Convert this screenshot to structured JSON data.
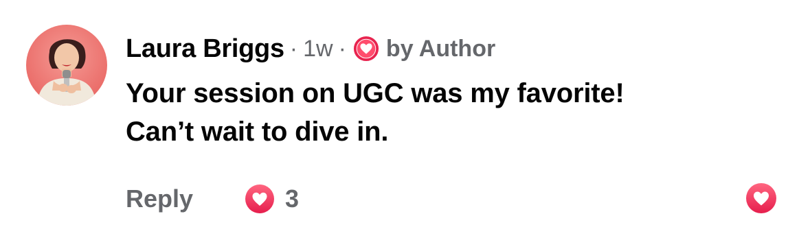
{
  "comment": {
    "author": "Laura Briggs",
    "separator": "·",
    "time": "1w",
    "author_badge": "by Author",
    "text_line1": "Your session on UGC was my favorite!",
    "text_line2": "Can’t wait to dive in."
  },
  "actions": {
    "reply_label": "Reply",
    "reaction_count": "3",
    "reaction_icon": "heart-icon",
    "like_icon": "heart-icon"
  },
  "colors": {
    "heart_gradient_top": "#ff6680",
    "heart_gradient_bottom": "#e61e4d",
    "secondary_text": "#65676b",
    "avatar_background": "#f07a78"
  }
}
